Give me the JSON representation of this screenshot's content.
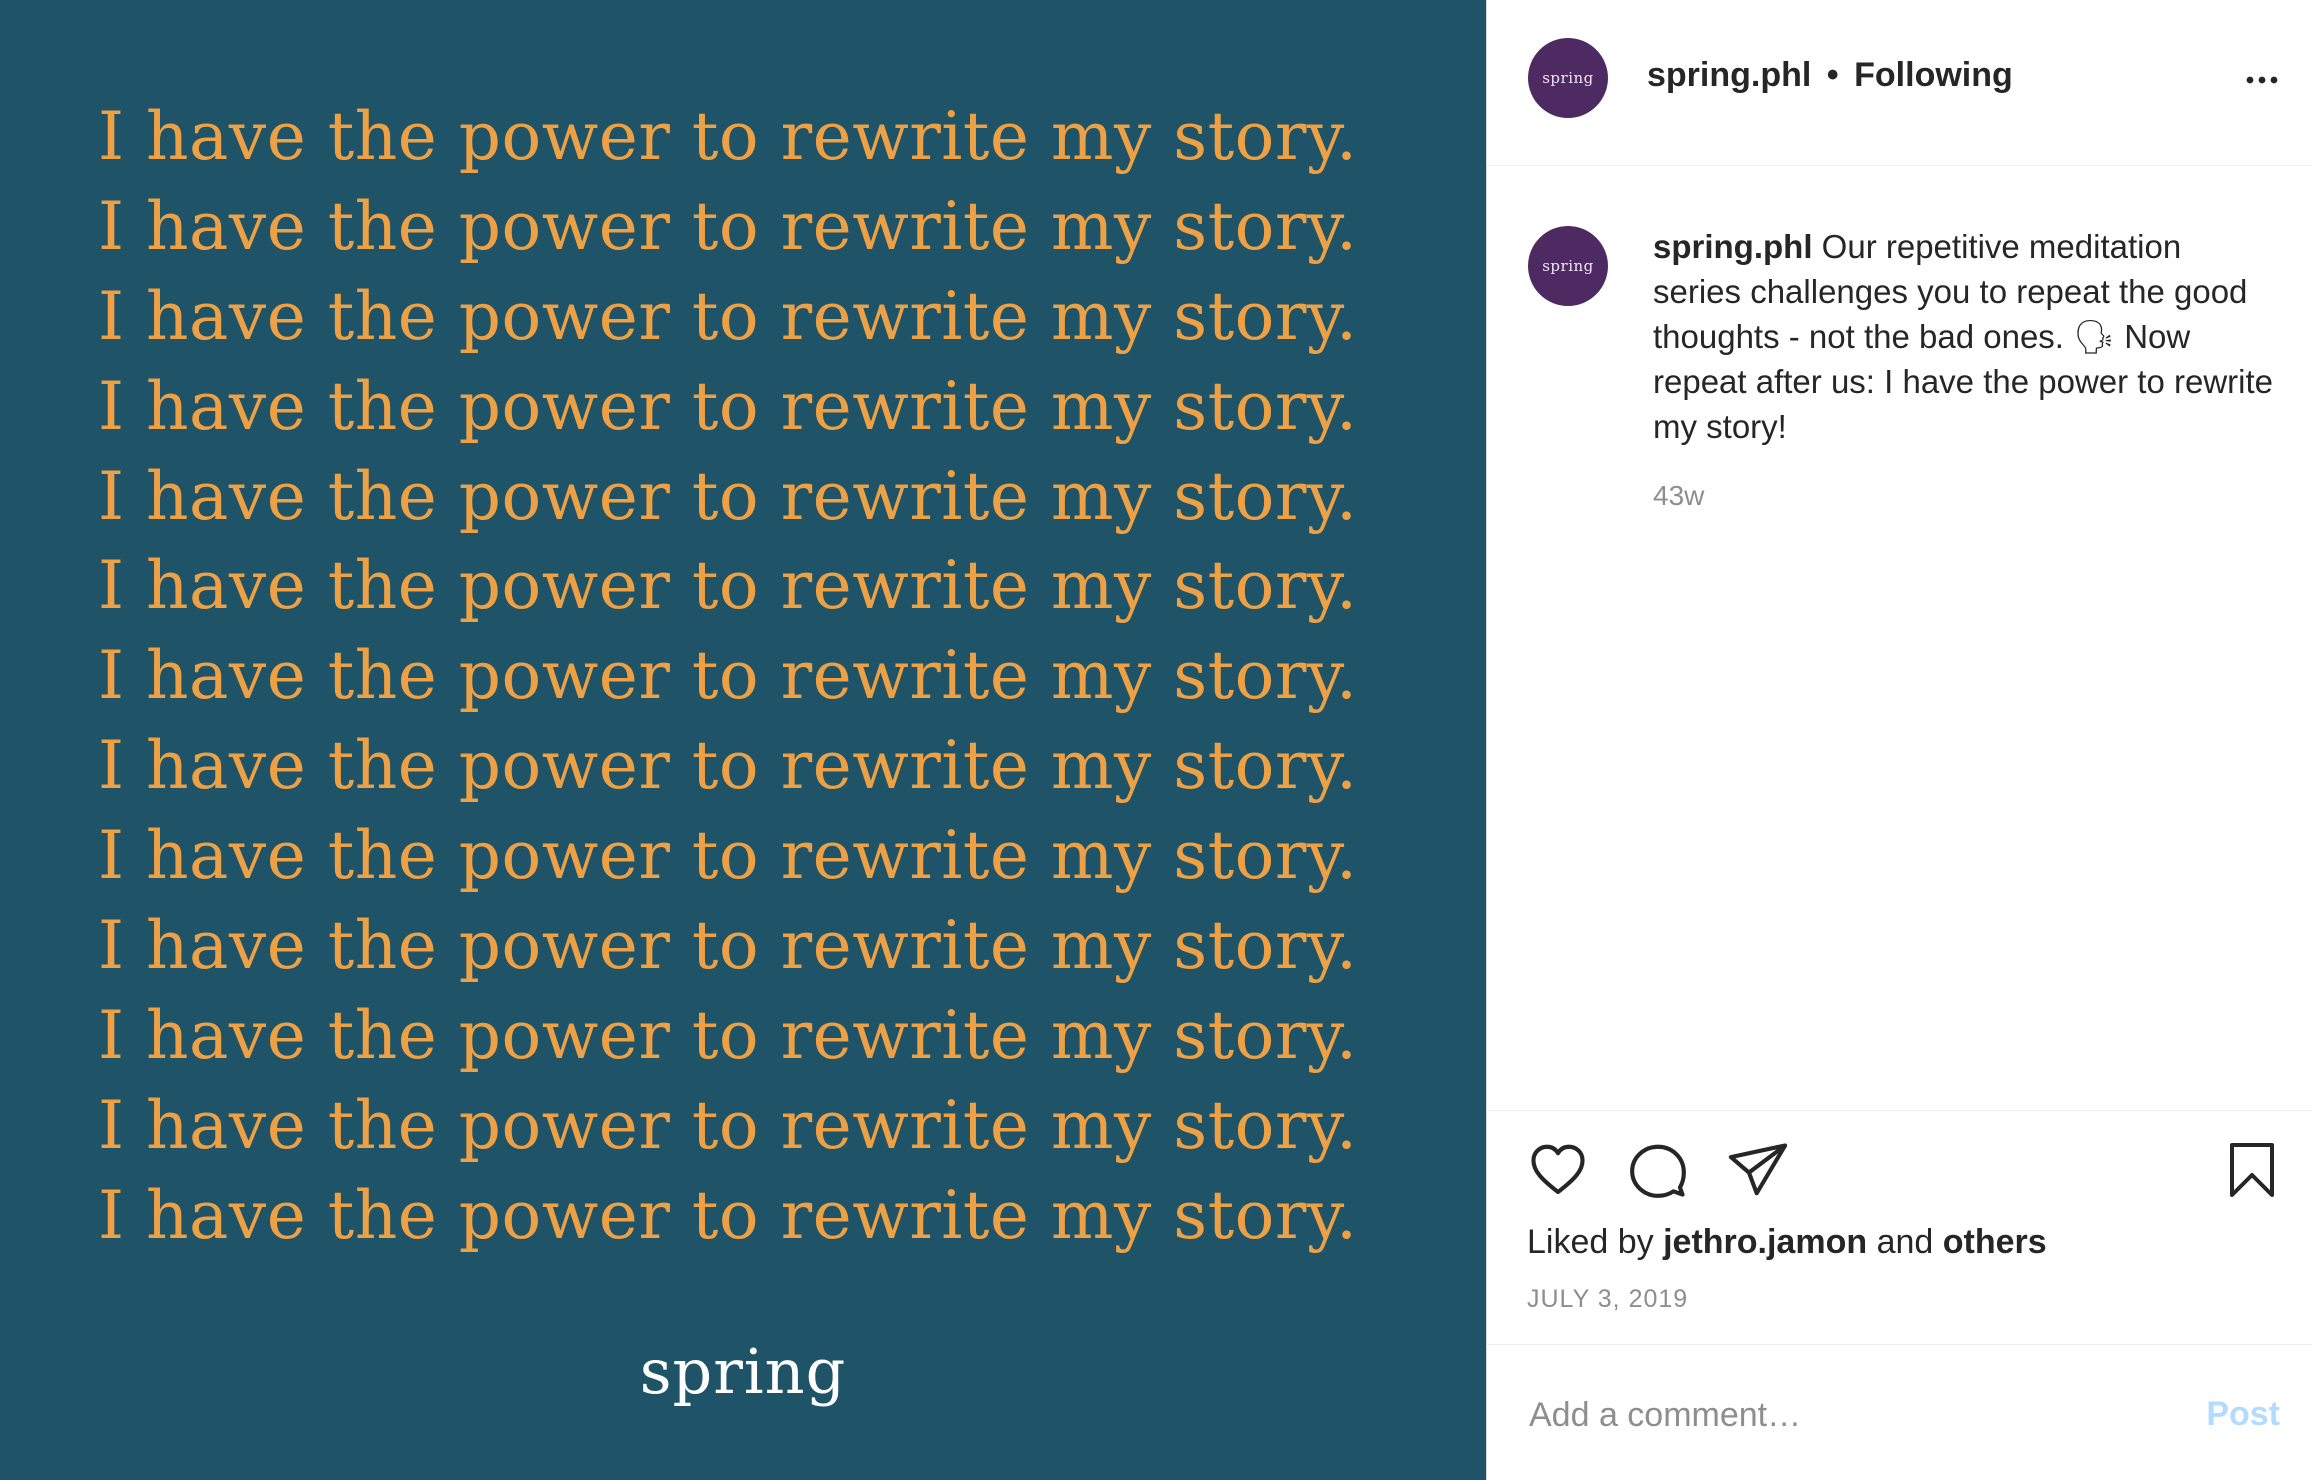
{
  "image": {
    "quote_lines": [
      "I have the power to rewrite my story.",
      "I have the power to rewrite my story.",
      "I have the power to rewrite my story.",
      "I have the power to rewrite my story.",
      "I have the power to rewrite my story.",
      "I have the power to rewrite my story.",
      "I have the power to rewrite my story.",
      "I have the power to rewrite my story.",
      "I have the power to rewrite my story.",
      "I have the power to rewrite my story.",
      "I have the power to rewrite my story.",
      "I have the power to rewrite my story.",
      "I have the power to rewrite my story."
    ],
    "brand": "spring",
    "background_color": "#1f5468",
    "text_color": "#eda044"
  },
  "header": {
    "avatar_text": "spring",
    "username": "spring.phl",
    "separator": "•",
    "follow_status": "Following",
    "more_icon": "more-horizontal-icon"
  },
  "caption": {
    "avatar_text": "spring",
    "username": "spring.phl",
    "text": "Our repetitive meditation series challenges you to repeat the good thoughts - not the bad ones. 🗣 Now repeat after us: I have the power to rewrite my story!",
    "time": "43w"
  },
  "actions": {
    "icons": [
      "heart-icon",
      "comment-icon",
      "share-icon",
      "bookmark-icon"
    ],
    "liked_by_prefix": "Liked by",
    "liked_by_user": "jethro.jamon",
    "liked_by_and": "and",
    "liked_by_others": "others",
    "date": "JULY 3, 2019"
  },
  "comment": {
    "placeholder": "Add a comment…",
    "post_label": "Post"
  },
  "colors": {
    "avatar": "#4e2a63",
    "post_button_disabled": "#b3dbff",
    "muted": "#8e8e8e"
  }
}
